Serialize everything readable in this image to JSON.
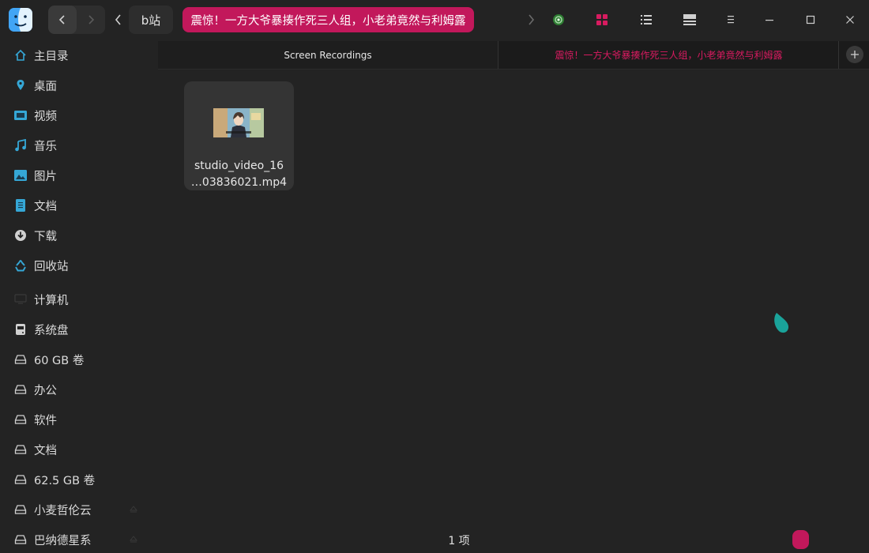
{
  "titlebar": {
    "breadcrumb_parent": "b站",
    "breadcrumb_current": "震惊！一方大爷暴揍作死三人组，小老弟竟然与利姆露"
  },
  "sidebar": {
    "items": [
      {
        "label": "主目录",
        "icon": "home-icon"
      },
      {
        "label": "桌面",
        "icon": "desktop-pin-icon"
      },
      {
        "label": "视频",
        "icon": "video-icon"
      },
      {
        "label": "音乐",
        "icon": "music-icon"
      },
      {
        "label": "图片",
        "icon": "picture-icon"
      },
      {
        "label": "文档",
        "icon": "document-icon"
      },
      {
        "label": "下载",
        "icon": "download-icon"
      },
      {
        "label": "回收站",
        "icon": "trash-icon"
      },
      {
        "label": "计算机",
        "icon": "computer-icon"
      },
      {
        "label": "系统盘",
        "icon": "system-disk-icon"
      },
      {
        "label": "60 GB 卷",
        "icon": "drive-icon"
      },
      {
        "label": "办公",
        "icon": "drive-icon"
      },
      {
        "label": "软件",
        "icon": "drive-icon"
      },
      {
        "label": "文档",
        "icon": "drive-icon"
      },
      {
        "label": "62.5 GB 卷",
        "icon": "drive-icon"
      },
      {
        "label": "小麦哲伦云",
        "icon": "drive-icon"
      },
      {
        "label": "巴纳德星系",
        "icon": "drive-icon"
      }
    ]
  },
  "tabs": [
    {
      "label": "Screen Recordings"
    },
    {
      "label": "震惊！一方大爷暴揍作死三人组，小老弟竟然与利姆露"
    }
  ],
  "files": [
    {
      "name_line1": "studio_video_16",
      "name_line2": "…03836021.mp4"
    }
  ],
  "status": {
    "item_count": "1 项"
  },
  "colors": {
    "accent": "#c2185b",
    "background": "#232323",
    "sidebar_icon": "#35a7d6"
  }
}
